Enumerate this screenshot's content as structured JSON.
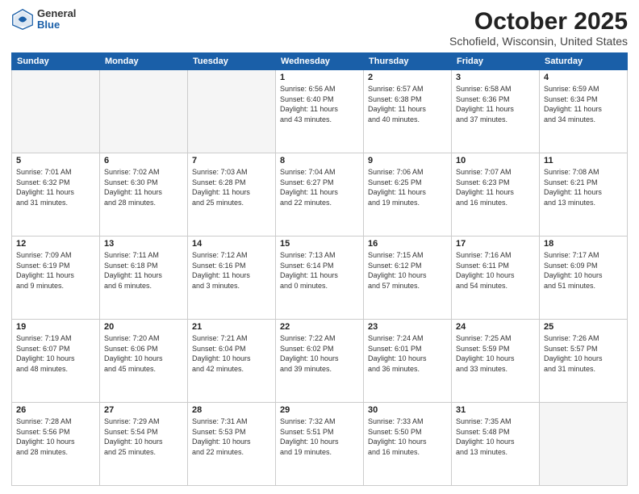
{
  "header": {
    "logo_general": "General",
    "logo_blue": "Blue",
    "month_title": "October 2025",
    "location": "Schofield, Wisconsin, United States"
  },
  "weekdays": [
    "Sunday",
    "Monday",
    "Tuesday",
    "Wednesday",
    "Thursday",
    "Friday",
    "Saturday"
  ],
  "weeks": [
    [
      {
        "day": "",
        "info": ""
      },
      {
        "day": "",
        "info": ""
      },
      {
        "day": "",
        "info": ""
      },
      {
        "day": "1",
        "info": "Sunrise: 6:56 AM\nSunset: 6:40 PM\nDaylight: 11 hours\nand 43 minutes."
      },
      {
        "day": "2",
        "info": "Sunrise: 6:57 AM\nSunset: 6:38 PM\nDaylight: 11 hours\nand 40 minutes."
      },
      {
        "day": "3",
        "info": "Sunrise: 6:58 AM\nSunset: 6:36 PM\nDaylight: 11 hours\nand 37 minutes."
      },
      {
        "day": "4",
        "info": "Sunrise: 6:59 AM\nSunset: 6:34 PM\nDaylight: 11 hours\nand 34 minutes."
      }
    ],
    [
      {
        "day": "5",
        "info": "Sunrise: 7:01 AM\nSunset: 6:32 PM\nDaylight: 11 hours\nand 31 minutes."
      },
      {
        "day": "6",
        "info": "Sunrise: 7:02 AM\nSunset: 6:30 PM\nDaylight: 11 hours\nand 28 minutes."
      },
      {
        "day": "7",
        "info": "Sunrise: 7:03 AM\nSunset: 6:28 PM\nDaylight: 11 hours\nand 25 minutes."
      },
      {
        "day": "8",
        "info": "Sunrise: 7:04 AM\nSunset: 6:27 PM\nDaylight: 11 hours\nand 22 minutes."
      },
      {
        "day": "9",
        "info": "Sunrise: 7:06 AM\nSunset: 6:25 PM\nDaylight: 11 hours\nand 19 minutes."
      },
      {
        "day": "10",
        "info": "Sunrise: 7:07 AM\nSunset: 6:23 PM\nDaylight: 11 hours\nand 16 minutes."
      },
      {
        "day": "11",
        "info": "Sunrise: 7:08 AM\nSunset: 6:21 PM\nDaylight: 11 hours\nand 13 minutes."
      }
    ],
    [
      {
        "day": "12",
        "info": "Sunrise: 7:09 AM\nSunset: 6:19 PM\nDaylight: 11 hours\nand 9 minutes."
      },
      {
        "day": "13",
        "info": "Sunrise: 7:11 AM\nSunset: 6:18 PM\nDaylight: 11 hours\nand 6 minutes."
      },
      {
        "day": "14",
        "info": "Sunrise: 7:12 AM\nSunset: 6:16 PM\nDaylight: 11 hours\nand 3 minutes."
      },
      {
        "day": "15",
        "info": "Sunrise: 7:13 AM\nSunset: 6:14 PM\nDaylight: 11 hours\nand 0 minutes."
      },
      {
        "day": "16",
        "info": "Sunrise: 7:15 AM\nSunset: 6:12 PM\nDaylight: 10 hours\nand 57 minutes."
      },
      {
        "day": "17",
        "info": "Sunrise: 7:16 AM\nSunset: 6:11 PM\nDaylight: 10 hours\nand 54 minutes."
      },
      {
        "day": "18",
        "info": "Sunrise: 7:17 AM\nSunset: 6:09 PM\nDaylight: 10 hours\nand 51 minutes."
      }
    ],
    [
      {
        "day": "19",
        "info": "Sunrise: 7:19 AM\nSunset: 6:07 PM\nDaylight: 10 hours\nand 48 minutes."
      },
      {
        "day": "20",
        "info": "Sunrise: 7:20 AM\nSunset: 6:06 PM\nDaylight: 10 hours\nand 45 minutes."
      },
      {
        "day": "21",
        "info": "Sunrise: 7:21 AM\nSunset: 6:04 PM\nDaylight: 10 hours\nand 42 minutes."
      },
      {
        "day": "22",
        "info": "Sunrise: 7:22 AM\nSunset: 6:02 PM\nDaylight: 10 hours\nand 39 minutes."
      },
      {
        "day": "23",
        "info": "Sunrise: 7:24 AM\nSunset: 6:01 PM\nDaylight: 10 hours\nand 36 minutes."
      },
      {
        "day": "24",
        "info": "Sunrise: 7:25 AM\nSunset: 5:59 PM\nDaylight: 10 hours\nand 33 minutes."
      },
      {
        "day": "25",
        "info": "Sunrise: 7:26 AM\nSunset: 5:57 PM\nDaylight: 10 hours\nand 31 minutes."
      }
    ],
    [
      {
        "day": "26",
        "info": "Sunrise: 7:28 AM\nSunset: 5:56 PM\nDaylight: 10 hours\nand 28 minutes."
      },
      {
        "day": "27",
        "info": "Sunrise: 7:29 AM\nSunset: 5:54 PM\nDaylight: 10 hours\nand 25 minutes."
      },
      {
        "day": "28",
        "info": "Sunrise: 7:31 AM\nSunset: 5:53 PM\nDaylight: 10 hours\nand 22 minutes."
      },
      {
        "day": "29",
        "info": "Sunrise: 7:32 AM\nSunset: 5:51 PM\nDaylight: 10 hours\nand 19 minutes."
      },
      {
        "day": "30",
        "info": "Sunrise: 7:33 AM\nSunset: 5:50 PM\nDaylight: 10 hours\nand 16 minutes."
      },
      {
        "day": "31",
        "info": "Sunrise: 7:35 AM\nSunset: 5:48 PM\nDaylight: 10 hours\nand 13 minutes."
      },
      {
        "day": "",
        "info": ""
      }
    ]
  ]
}
